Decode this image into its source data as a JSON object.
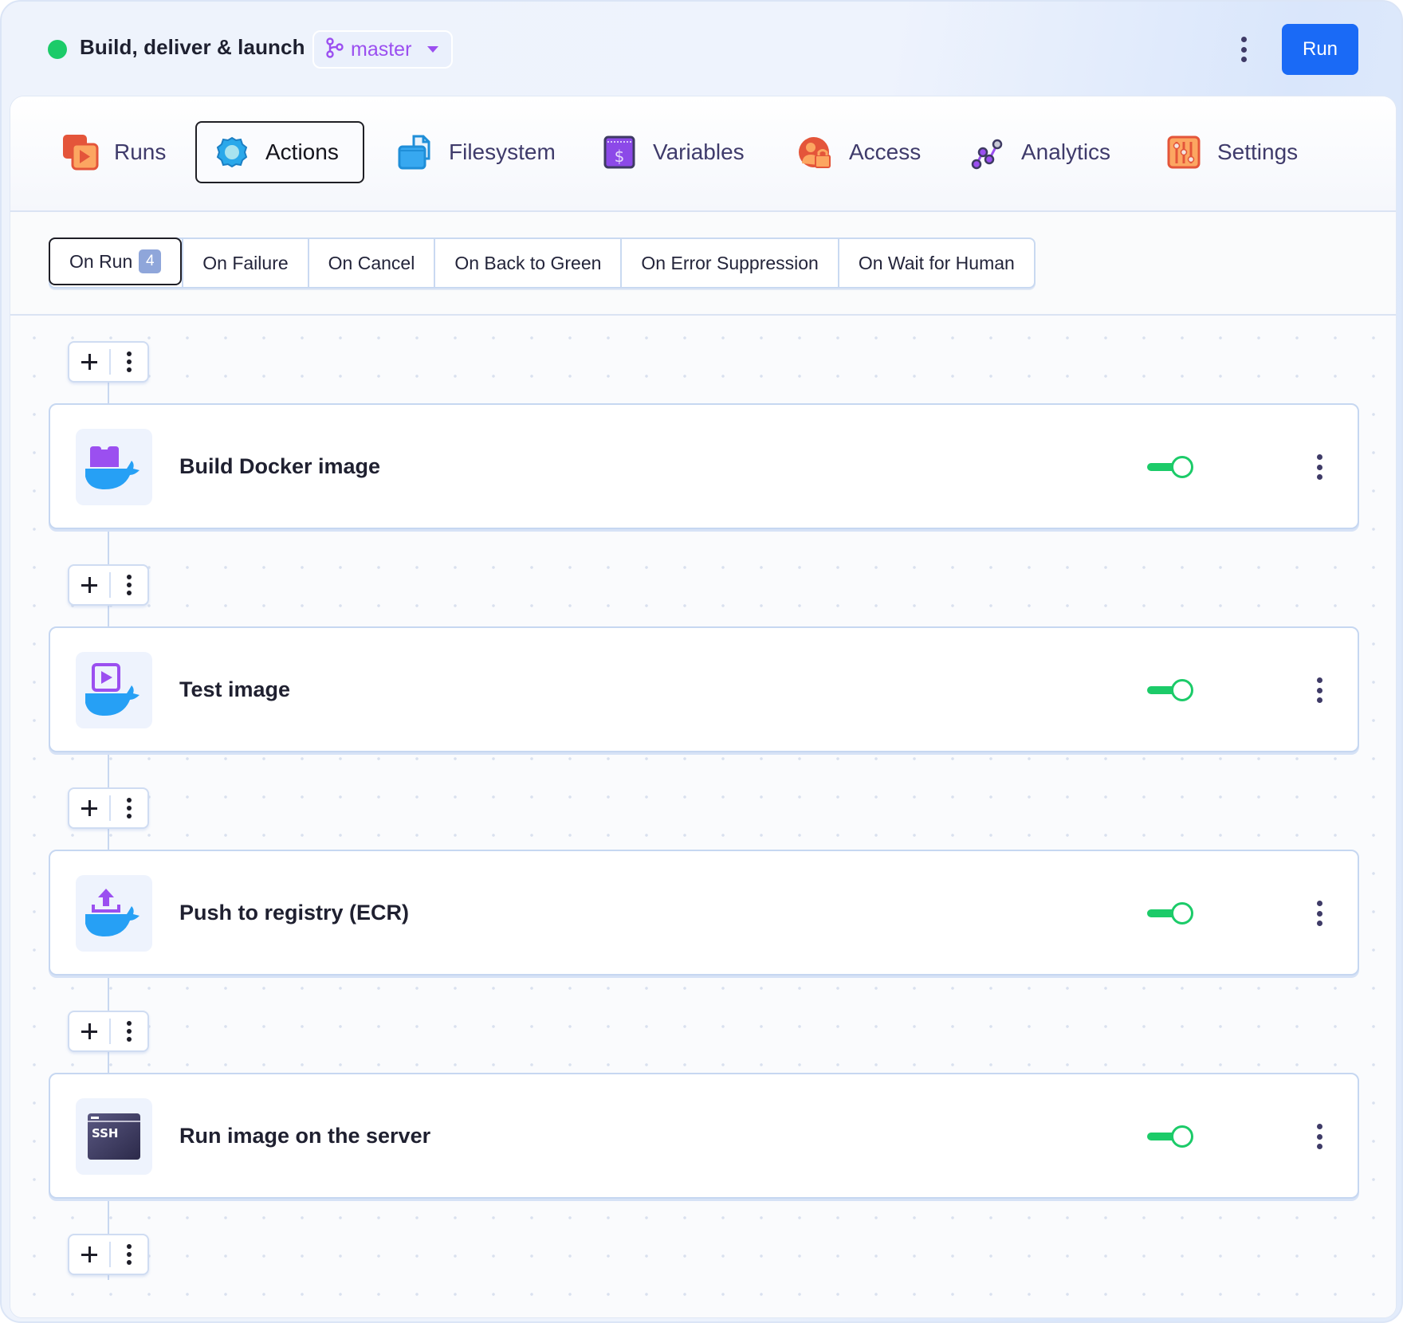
{
  "header": {
    "pipeline_title": "Build, deliver & launch",
    "status": "active",
    "status_color": "#1ccb69",
    "branch": "master",
    "branch_icon": "git-branch-icon",
    "run_label": "Run",
    "accent_color": "#1a6af6"
  },
  "nav": {
    "items": [
      {
        "label": "Runs",
        "icon": "runs-icon",
        "active": false
      },
      {
        "label": "Actions",
        "icon": "actions-gear-icon",
        "active": true
      },
      {
        "label": "Filesystem",
        "icon": "filesystem-icon",
        "active": false
      },
      {
        "label": "Variables",
        "icon": "variables-dollar-icon",
        "active": false
      },
      {
        "label": "Access",
        "icon": "access-user-lock-icon",
        "active": false
      },
      {
        "label": "Analytics",
        "icon": "analytics-icon",
        "active": false
      },
      {
        "label": "Settings",
        "icon": "settings-sliders-icon",
        "active": false
      }
    ]
  },
  "subtabs": {
    "items": [
      {
        "label": "On Run",
        "badge": "4",
        "active": true
      },
      {
        "label": "On Failure",
        "active": false
      },
      {
        "label": "On Cancel",
        "active": false
      },
      {
        "label": "On Back to Green",
        "active": false
      },
      {
        "label": "On Error Suppression",
        "active": false
      },
      {
        "label": "On Wait for Human",
        "active": false
      }
    ]
  },
  "actions": [
    {
      "name": "Build Docker image",
      "icon": "docker-build-icon",
      "enabled": true
    },
    {
      "name": "Test image",
      "icon": "docker-test-icon",
      "enabled": true
    },
    {
      "name": "Push to registry (ECR)",
      "icon": "docker-push-icon",
      "enabled": true
    },
    {
      "name": "Run image on the server",
      "icon": "ssh-terminal-icon",
      "enabled": true,
      "icon_text": "SSH"
    }
  ],
  "toggle_color": "#1ccb69"
}
